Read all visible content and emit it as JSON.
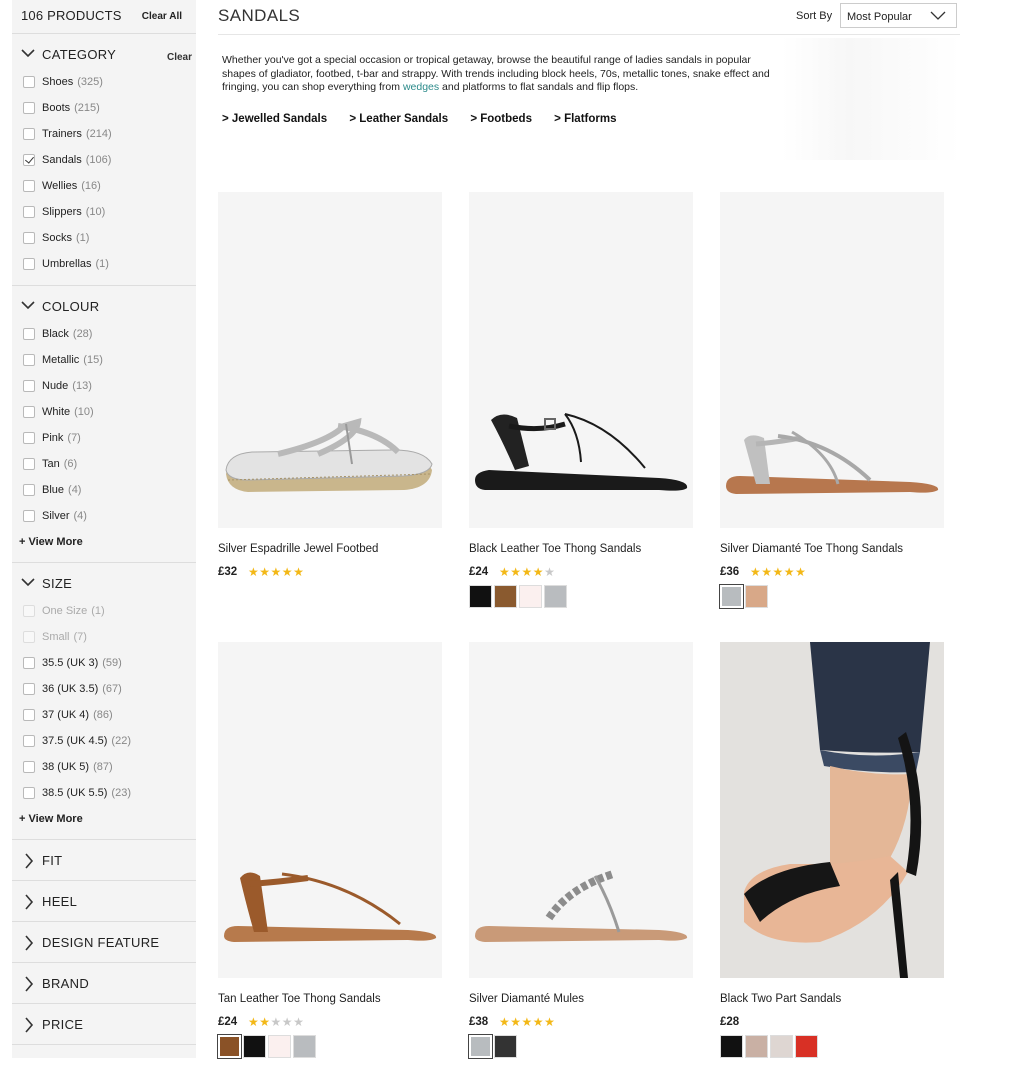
{
  "sidebar": {
    "product_count": "106 PRODUCTS",
    "clear_all": "Clear All",
    "category": {
      "title": "CATEGORY",
      "clear": "Clear",
      "options": [
        {
          "label": "Shoes",
          "count": "(325)",
          "checked": false
        },
        {
          "label": "Boots",
          "count": "(215)",
          "checked": false
        },
        {
          "label": "Trainers",
          "count": "(214)",
          "checked": false
        },
        {
          "label": "Sandals",
          "count": "(106)",
          "checked": true
        },
        {
          "label": "Wellies",
          "count": "(16)",
          "checked": false
        },
        {
          "label": "Slippers",
          "count": "(10)",
          "checked": false
        },
        {
          "label": "Socks",
          "count": "(1)",
          "checked": false
        },
        {
          "label": "Umbrellas",
          "count": "(1)",
          "checked": false
        }
      ]
    },
    "colour": {
      "title": "COLOUR",
      "options": [
        {
          "label": "Black",
          "count": "(28)"
        },
        {
          "label": "Metallic",
          "count": "(15)"
        },
        {
          "label": "Nude",
          "count": "(13)"
        },
        {
          "label": "White",
          "count": "(10)"
        },
        {
          "label": "Pink",
          "count": "(7)"
        },
        {
          "label": "Tan",
          "count": "(6)"
        },
        {
          "label": "Blue",
          "count": "(4)"
        },
        {
          "label": "Silver",
          "count": "(4)"
        }
      ],
      "view_more": "+ View More"
    },
    "size": {
      "title": "SIZE",
      "options": [
        {
          "label": "One Size",
          "count": "(1)",
          "disabled": true
        },
        {
          "label": "Small",
          "count": "(7)",
          "disabled": true
        },
        {
          "label": "35.5 (UK 3)",
          "count": "(59)",
          "disabled": false
        },
        {
          "label": "36 (UK 3.5)",
          "count": "(67)",
          "disabled": false
        },
        {
          "label": "37 (UK 4)",
          "count": "(86)",
          "disabled": false
        },
        {
          "label": "37.5 (UK 4.5)",
          "count": "(22)",
          "disabled": false
        },
        {
          "label": "38 (UK 5)",
          "count": "(87)",
          "disabled": false
        },
        {
          "label": "38.5 (UK 5.5)",
          "count": "(23)",
          "disabled": false
        }
      ],
      "view_more": "+ View More"
    },
    "collapsed": [
      "FIT",
      "HEEL",
      "DESIGN FEATURE",
      "BRAND",
      "PRICE"
    ]
  },
  "header": {
    "title": "SANDALS",
    "sort_label": "Sort By",
    "sort_value": "Most Popular"
  },
  "intro": {
    "text_before": "Whether you've got a special occasion or tropical getaway, browse the beautiful range of ladies sandals in popular shapes of gladiator, footbed, t-bar and strappy. With trends including block heels, 70s, metallic tones, snake effect and fringing, you can shop everything from ",
    "link": "wedges",
    "text_after": " and platforms to flat sandals and flip flops.",
    "sublinks": [
      "> Jewelled Sandals",
      "> Leather Sandals",
      "> Footbeds",
      "> Flatforms"
    ]
  },
  "colors": {
    "star": "#f3b817",
    "link": "#2b8a8a",
    "sidebar_bg": "#f4f4f4"
  },
  "products": [
    {
      "name": "Silver Espadrille Jewel Footbed",
      "price": "£32",
      "rating": 5,
      "swatches": [],
      "image": "silver-espadrille-sandal"
    },
    {
      "name": "Black Leather Toe Thong Sandals",
      "price": "£24",
      "rating": 4.5,
      "swatches": [
        "#111111",
        "#8a5a2f",
        "#fbf0ef",
        "#b9bcbf"
      ],
      "image": "black-thong-sandal"
    },
    {
      "name": "Silver Diamanté Toe Thong Sandals",
      "price": "£36",
      "rating": 5,
      "swatches": [
        "#b8bcbf",
        "#d8a888"
      ],
      "selected": 0,
      "image": "silver-diamante-thong"
    },
    {
      "name": "Tan Leather Toe Thong Sandals",
      "price": "£24",
      "rating": 2,
      "swatches": [
        "#8a5227",
        "#111111",
        "#fbf0ef",
        "#b9bcbf"
      ],
      "selected": 0,
      "image": "tan-thong-sandal"
    },
    {
      "name": "Silver Diamanté Mules",
      "price": "£38",
      "rating": 5,
      "swatches": [
        "#b8bcbf",
        "#333333"
      ],
      "selected": 0,
      "image": "silver-diamante-mule"
    },
    {
      "name": "Black Two Part Sandals",
      "price": "£28",
      "rating": 0,
      "swatches": [
        "#111111",
        "#c9b0a4",
        "#ded6d2",
        "#d83025"
      ],
      "image": "black-heel-on-foot"
    }
  ]
}
